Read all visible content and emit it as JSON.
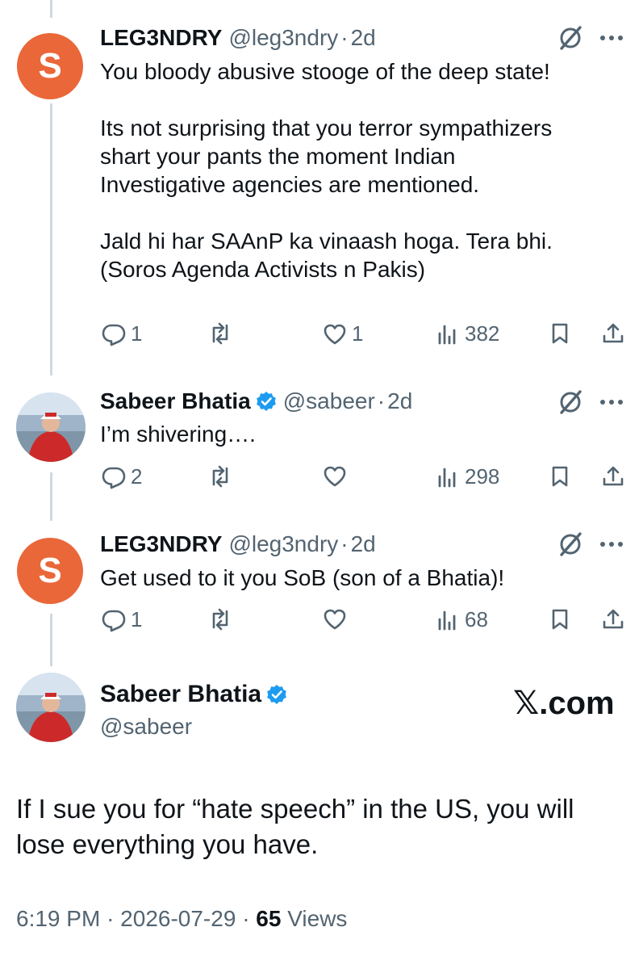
{
  "tweets": [
    {
      "author_name": "LEG3NDRY",
      "author_handle": "@leg3ndry",
      "age": "2d",
      "avatar_letter": "S",
      "text_paragraphs": [
        [
          "You bloody abusive stooge of the deep state!"
        ],
        [
          "Its not surprising that you terror sympathizers",
          "shart your pants the moment Indian",
          "Investigative agencies are mentioned."
        ],
        [
          "Jald hi har SAAnP ka vinaash hoga. Tera bhi.",
          "(Soros Agenda Activists n Pakis)"
        ]
      ],
      "replies": "1",
      "retweets": "",
      "likes": "1",
      "views": "382"
    },
    {
      "author_name": "Sabeer Bhatia",
      "author_handle": "@sabeer",
      "age": "2d",
      "verified": true,
      "text": "I’m shivering….",
      "replies": "2",
      "retweets": "",
      "likes": "",
      "views": "298"
    },
    {
      "author_name": "LEG3NDRY",
      "author_handle": "@leg3ndry",
      "age": "2d",
      "avatar_letter": "S",
      "text": "Get used to it you SoB (son of a Bhatia)!",
      "replies": "1",
      "retweets": "",
      "likes": "",
      "views": "68"
    }
  ],
  "main_tweet": {
    "author_name": "Sabeer Bhatia",
    "author_handle": "@sabeer",
    "verified": true,
    "text_line1": "If I sue you for “hate speech” in the US, you will",
    "text_line2": "lose everything you have.",
    "time": "6:19 PM",
    "date": "2026-07-29",
    "views_count": "65",
    "views_label": "Views"
  },
  "watermark": "𝕏.com",
  "separators": {
    "dot": "·"
  },
  "colors": {
    "text": "#0f1419",
    "secondary": "#536471",
    "verified_blue": "#1d9bf0",
    "avatar_orange": "#ea6739",
    "thread_line": "#cfd9de"
  },
  "icons": [
    "reply-icon",
    "retweet-icon",
    "like-icon",
    "views-icon",
    "bookmark-icon",
    "share-icon",
    "grok-icon",
    "more-icon",
    "verified-badge-icon"
  ]
}
